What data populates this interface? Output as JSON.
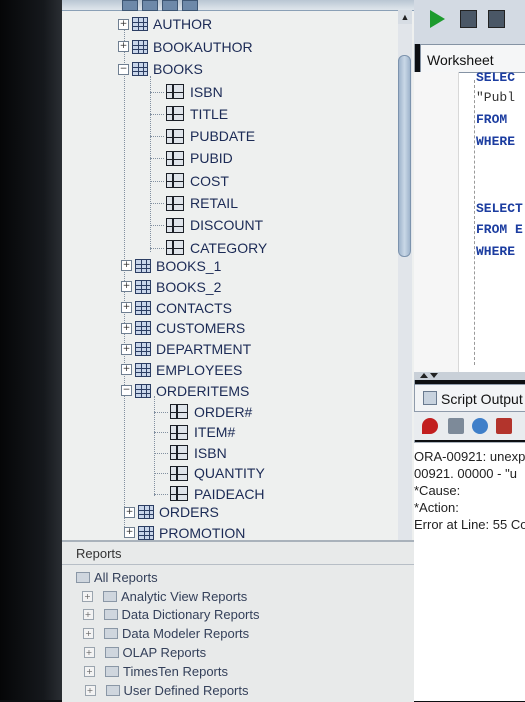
{
  "tree": {
    "tables_before": [
      {
        "label": "AUTHOR",
        "expander": "+"
      },
      {
        "label": "BOOKAUTHOR",
        "expander": "+"
      },
      {
        "label": "BOOKS",
        "expander": "−"
      }
    ],
    "books_columns": [
      "ISBN",
      "TITLE",
      "PUBDATE",
      "PUBID",
      "COST",
      "RETAIL",
      "DISCOUNT",
      "CATEGORY"
    ],
    "tables_middle": [
      {
        "label": "BOOKS_1",
        "expander": "+"
      },
      {
        "label": "BOOKS_2",
        "expander": "+"
      },
      {
        "label": "CONTACTS",
        "expander": "+"
      },
      {
        "label": "CUSTOMERS",
        "expander": "+"
      },
      {
        "label": "DEPARTMENT",
        "expander": "+"
      },
      {
        "label": "EMPLOYEES",
        "expander": "+"
      },
      {
        "label": "ORDERITEMS",
        "expander": "−"
      }
    ],
    "orderitems_columns": [
      "ORDER#",
      "ITEM#",
      "ISBN",
      "QUANTITY",
      "PAIDEACH"
    ],
    "tables_after": [
      {
        "label": "ORDERS",
        "expander": "+"
      },
      {
        "label": "PROMOTION",
        "expander": "+"
      }
    ]
  },
  "reports": {
    "title": "Reports",
    "root": "All Reports",
    "items": [
      "Analytic View Reports",
      "Data Dictionary Reports",
      "Data Modeler Reports",
      "OLAP Reports",
      "TimesTen Reports",
      "User Defined Reports"
    ]
  },
  "worksheet": {
    "tab_label": "Worksheet",
    "code": [
      {
        "text": "SELEC",
        "kind": "kw"
      },
      {
        "text": "\"Publ",
        "kind": "str"
      },
      {
        "text": "FROM",
        "kind": "kw"
      },
      {
        "text": "WHERE",
        "kind": "kw"
      },
      {
        "text": "SELECT",
        "kind": "kw"
      },
      {
        "text": "FROM E",
        "kind": "kw"
      },
      {
        "text": "WHERE",
        "kind": "kw"
      }
    ]
  },
  "script_output": {
    "tab_label": "Script Output",
    "lines": [
      "ORA-00921: unexp",
      "00921. 00000 -  \"u",
      "*Cause:",
      "*Action:",
      "Error at Line: 55 Co"
    ]
  },
  "colors": {
    "run_green": "#1d9b2e",
    "keyword_blue": "#1c3da0",
    "tree_text": "#1b2a55"
  }
}
